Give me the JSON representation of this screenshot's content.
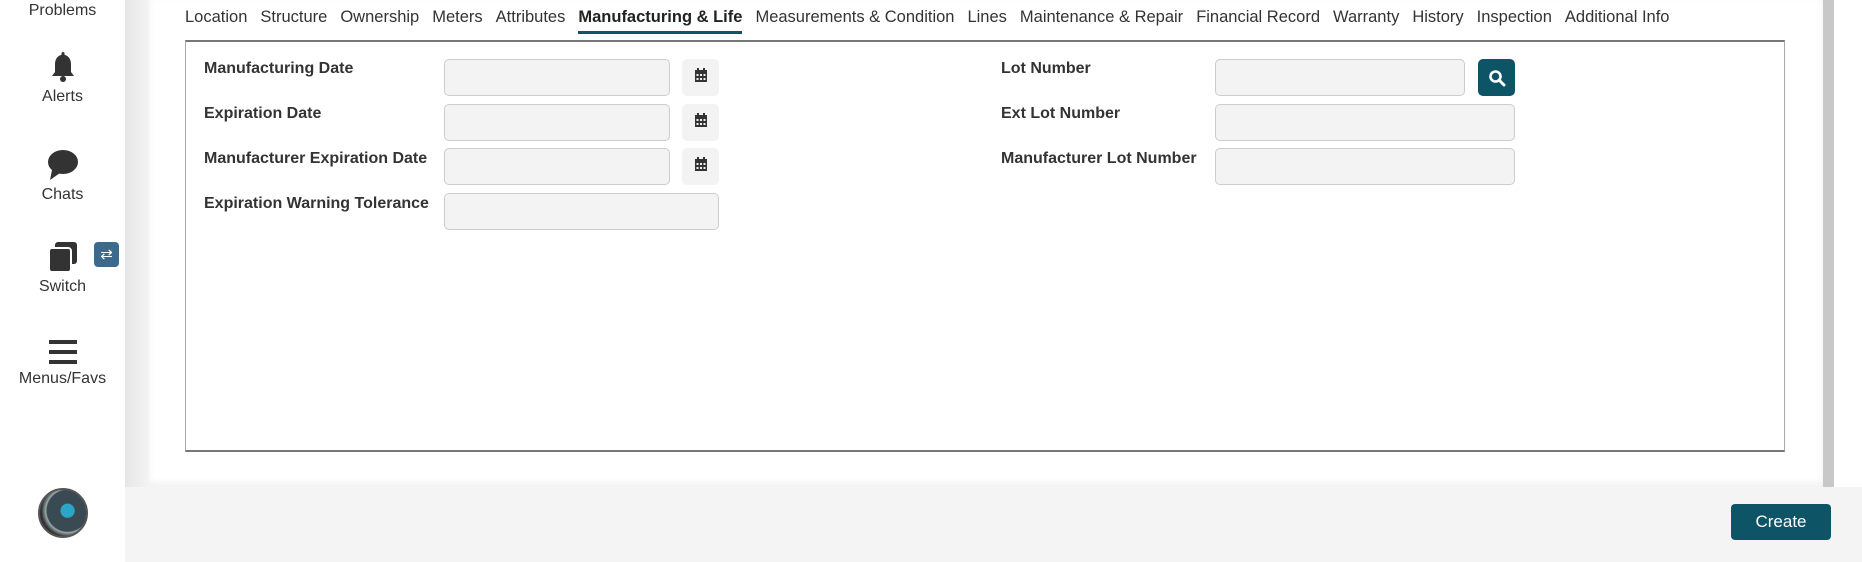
{
  "sidebar": {
    "items": [
      {
        "label": "Problems",
        "icon": "problems-icon"
      },
      {
        "label": "Alerts",
        "icon": "bell-icon"
      },
      {
        "label": "Chats",
        "icon": "chat-bubble-icon"
      },
      {
        "label": "Switch",
        "icon": "windows-icon"
      },
      {
        "label": "Menus/Favs",
        "icon": "hamburger-icon"
      }
    ],
    "avatar": "user-avatar"
  },
  "tabs": [
    "Location",
    "Structure",
    "Ownership",
    "Meters",
    "Attributes",
    "Manufacturing & Life",
    "Measurements & Condition",
    "Lines",
    "Maintenance & Repair",
    "Financial Record",
    "Warranty",
    "History",
    "Inspection",
    "Additional Info"
  ],
  "active_tab": "Manufacturing & Life",
  "form": {
    "left": [
      {
        "label": "Manufacturing Date",
        "value": ""
      },
      {
        "label": "Expiration Date",
        "value": ""
      },
      {
        "label": "Manufacturer Expiration Date",
        "value": ""
      },
      {
        "label": "Expiration Warning Tolerance",
        "value": ""
      }
    ],
    "right": [
      {
        "label": "Lot Number",
        "value": ""
      },
      {
        "label": "Ext Lot Number",
        "value": ""
      },
      {
        "label": "Manufacturer Lot Number",
        "value": ""
      }
    ]
  },
  "footer": {
    "create_label": "Create"
  },
  "colors": {
    "accent": "#0d5566",
    "switch_badge": "#3b6a8c"
  }
}
